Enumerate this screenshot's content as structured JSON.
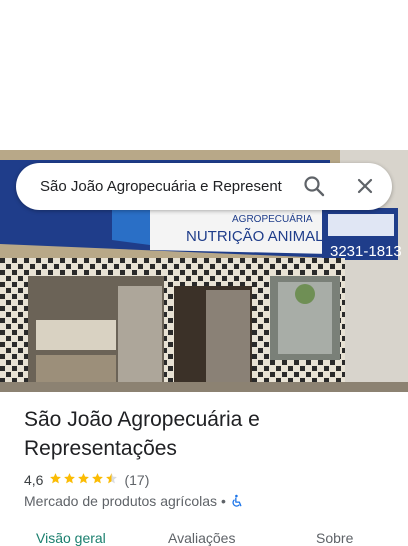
{
  "search": {
    "query": "São João Agropecuária e Represent"
  },
  "photo": {
    "sign_line1": "AGROPECUÁRIA",
    "sign_line2": "NUTRIÇÃO ANIMAL",
    "sign_phone": "3231-1813"
  },
  "place": {
    "title": "São João Agropecuária e Representações",
    "rating": "4,6",
    "stars": 4.5,
    "review_count": "(17)",
    "category": "Mercado de produtos agrícolas",
    "separator": "•"
  },
  "tabs": [
    {
      "label": "Visão geral",
      "active": true
    },
    {
      "label": "Avaliações",
      "active": false
    },
    {
      "label": "Sobre",
      "active": false
    }
  ],
  "colors": {
    "accent": "#1a7f6e",
    "star": "#fbbc04",
    "accessible_icon": "#1a73e8"
  }
}
